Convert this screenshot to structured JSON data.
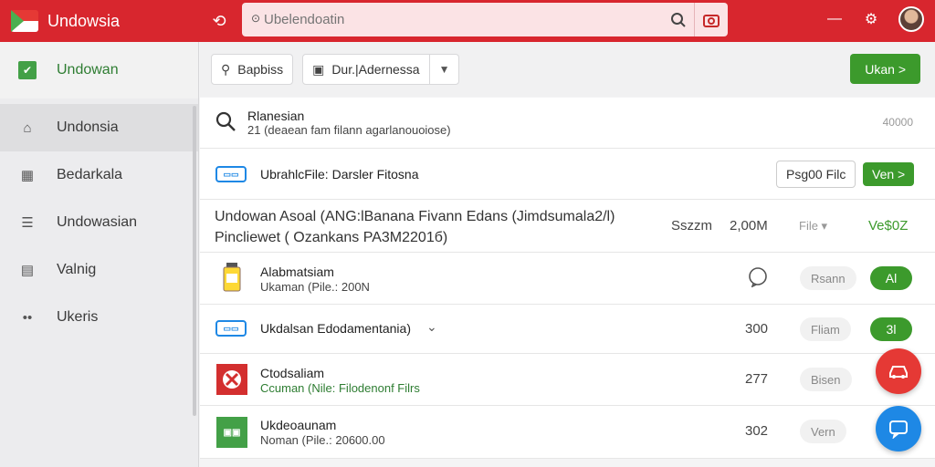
{
  "app": {
    "title": "Undowsia"
  },
  "search": {
    "placeholder": "Ubelendoatin"
  },
  "sidebar": {
    "items": [
      {
        "label": "Undowan",
        "icon": "check-box-icon"
      },
      {
        "label": "Undonsia",
        "icon": "home-icon"
      },
      {
        "label": "Bedarkala",
        "icon": "calendar-icon"
      },
      {
        "label": "Undowasian",
        "icon": "layers-icon"
      },
      {
        "label": "Valnig",
        "icon": "grid-icon"
      },
      {
        "label": "Ukeris",
        "icon": "more-icon"
      }
    ]
  },
  "toolbar": {
    "filter_label": "Bapbiss",
    "dropdown_label": "Dur.|Adernessa",
    "primary_label": "Ukan >"
  },
  "list": {
    "row1": {
      "title": "Rlanesian",
      "subtitle": "21 (deaean fam filann agarlanouoiose)",
      "meta": "40000"
    },
    "row2": {
      "title": "UbrahlcFile: Darsler Fitosna",
      "outline_btn": "Psg00 Filc",
      "green_btn": "Ven >"
    },
    "row3": {
      "line1": "Undowan Asoal (ANG:lBanana Fivann Edans (Jimdsumala2/l)",
      "line2": "Pincliewet ( Ozankans PA3M2201б)",
      "col1": "Sszzm",
      "col2": "2,00M",
      "pill": "File ▾",
      "value": "Ve$0Z"
    },
    "row4": {
      "title": "Alabmatsiam",
      "subtitle": "Ukaman (Pile.: 200N",
      "pill": "Rsann",
      "badge": "Al"
    },
    "row5": {
      "title": "Ukdalsan Edodamentania)",
      "num": "300",
      "pill": "Fliam",
      "badge": "3l"
    },
    "row6": {
      "title": "Ctodsaliam",
      "subtitle_a": "Ccuman (Nile:",
      "subtitle_b": "Filodenonf Filrs",
      "num": "277",
      "pill": "Bisen"
    },
    "row7": {
      "title": "Ukdeoaunam",
      "subtitle": "Noman (Pile.: 20600.00",
      "num": "302",
      "pill": "Vern"
    }
  },
  "colors": {
    "brand_red": "#d8262e",
    "accent_green": "#3c9a2c",
    "fab_red": "#e53935",
    "fab_blue": "#1e88e5"
  }
}
